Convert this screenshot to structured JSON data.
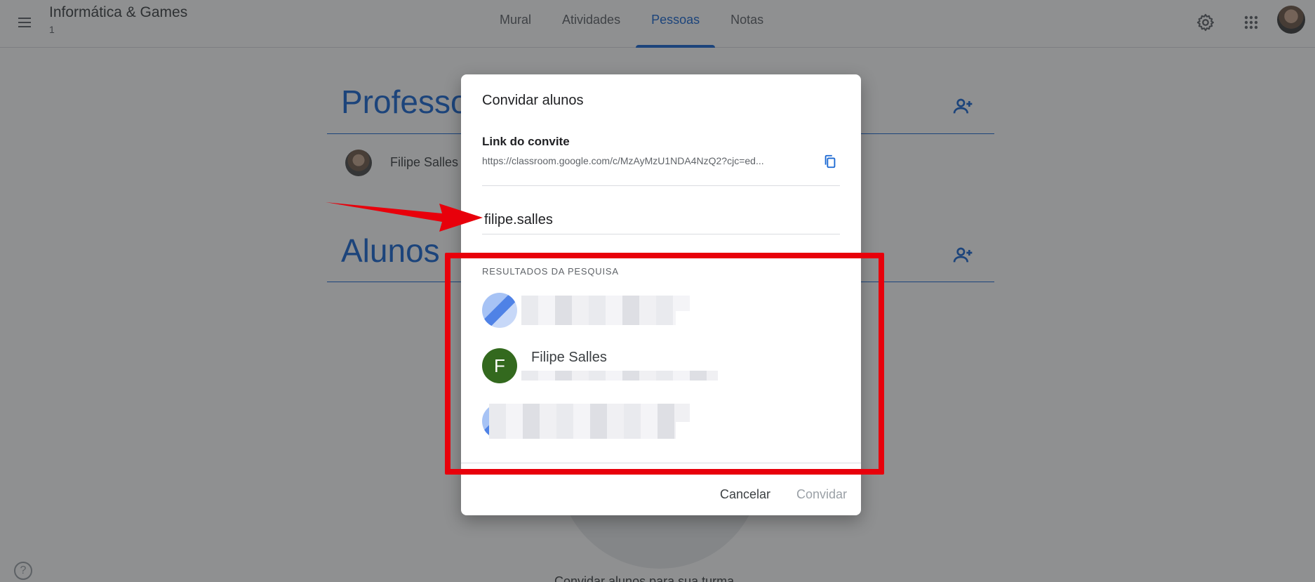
{
  "header": {
    "class_title": "Informática & Games",
    "class_subtitle": "1",
    "tabs": [
      {
        "label": "Mural",
        "active": false
      },
      {
        "label": "Atividades",
        "active": false
      },
      {
        "label": "Pessoas",
        "active": true
      },
      {
        "label": "Notas",
        "active": false
      }
    ],
    "icons": [
      "menu-icon",
      "gear-icon",
      "apps-icon",
      "account-avatar"
    ]
  },
  "page": {
    "teachers_title": "Professores",
    "teacher_name": "Filipe Salles",
    "students_title": "Alunos",
    "empty_text": "Convidar alunos para sua turma",
    "help_icon": "?"
  },
  "dialog": {
    "title": "Convidar alunos",
    "link_label": "Link do convite",
    "link_url": "https://classroom.google.com/c/MzAyMzU1NDA4NzQ2?cjc=ed...",
    "search_value": "filipe.salles",
    "results_label": "RESULTADOS DA PESQUISA",
    "results": [
      {
        "name": "",
        "initial": "",
        "blurred": true
      },
      {
        "name": "Filipe Salles",
        "initial": "F",
        "blurred": false,
        "avatar_color": "#33691e"
      },
      {
        "name": "",
        "initial": "",
        "blurred": true
      }
    ],
    "cancel_label": "Cancelar",
    "invite_label": "Convidar"
  },
  "colors": {
    "accent": "#1967d2",
    "annotation": "#e8000b"
  }
}
